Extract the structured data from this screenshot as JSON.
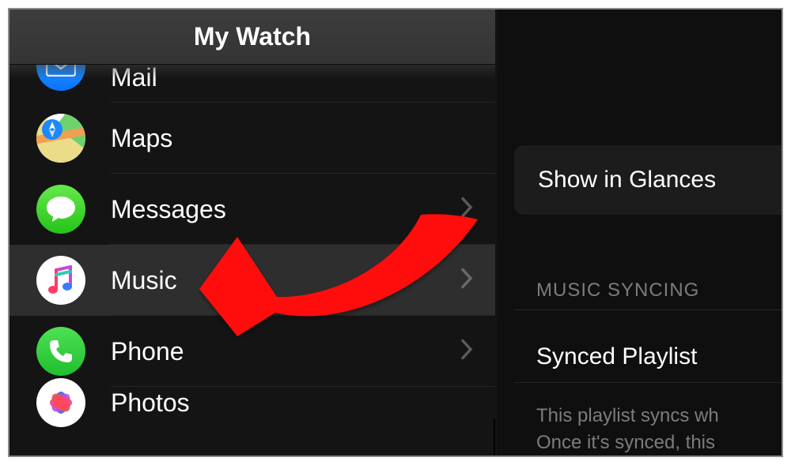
{
  "header": {
    "title": "My Watch"
  },
  "list": {
    "items": [
      {
        "label": "Mail",
        "icon": "mail-icon",
        "chevron": false
      },
      {
        "label": "Maps",
        "icon": "maps-icon",
        "chevron": false
      },
      {
        "label": "Messages",
        "icon": "messages-icon",
        "chevron": true
      },
      {
        "label": "Music",
        "icon": "music-icon",
        "chevron": true,
        "selected": true
      },
      {
        "label": "Phone",
        "icon": "phone-icon",
        "chevron": true
      },
      {
        "label": "Photos",
        "icon": "photos-icon",
        "chevron": false
      }
    ]
  },
  "right": {
    "glances_label": "Show in Glances",
    "section_title": "MUSIC SYNCING",
    "synced_label": "Synced Playlist",
    "note_line1": "This playlist syncs wh",
    "note_line2": "Once it's synced, this"
  }
}
